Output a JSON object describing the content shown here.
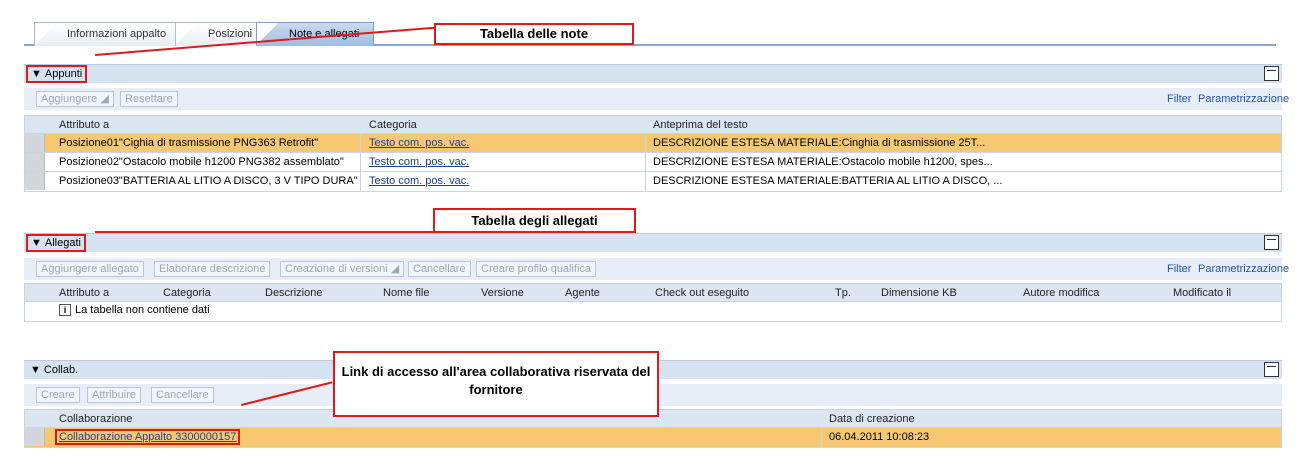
{
  "tabs": [
    "Informazioni appalto",
    "Posizioni",
    "Note e allegati"
  ],
  "callouts": {
    "notes": "Tabella delle note",
    "attachments": "Tabella degli allegati",
    "collab": "Link di accesso all'area collaborativa riservata del fornitore"
  },
  "appunti": {
    "title": "Appunti",
    "buttons": [
      "Aggiungere",
      "Resettare"
    ],
    "filter": "Filter",
    "settings": "Parametrizzazione",
    "columns": [
      "Attributo a",
      "Categoria",
      "Anteprima del testo"
    ],
    "rows": [
      {
        "attr": "Posizione01\"Cighia di trasmissione PNG363 Retrofit\"",
        "cat": "Testo com. pos. vac.",
        "preview": "DESCRIZIONE ESTESA MATERIALE:Cinghia di trasmissione 25T..."
      },
      {
        "attr": "Posizione02\"Ostacolo mobile h1200 PNG382 assemblato\"",
        "cat": "Testo com. pos. vac.",
        "preview": "DESCRIZIONE ESTESA MATERIALE:Ostacolo mobile h1200, spes..."
      },
      {
        "attr": "Posizione03\"BATTERIA AL LITIO A DISCO, 3 V TIPO DURA\"",
        "cat": "Testo com. pos. vac.",
        "preview": "DESCRIZIONE ESTESA MATERIALE:BATTERIA AL LITIO A DISCO, ..."
      }
    ]
  },
  "allegati": {
    "title": "Allegati",
    "buttons": [
      "Aggiungere allegato",
      "Elaborare descrizione",
      "Creazione di versioni",
      "Cancellare",
      "Creare profilo qualifica"
    ],
    "filter": "Filter",
    "settings": "Parametrizzazione",
    "columns": [
      "Attributo a",
      "Categoria",
      "Descrizione",
      "Nome file",
      "Versione",
      "Agente",
      "Check out eseguito",
      "Tp.",
      "Dimensione KB",
      "Autore modifica",
      "Modificato il"
    ],
    "empty": "La tabella non contiene dati"
  },
  "collab": {
    "title": "Collab.",
    "buttons": [
      "Creare",
      "Attribuire",
      "Cancellare"
    ],
    "columns": [
      "Collaborazione",
      "Data di creazione"
    ],
    "row": {
      "name": "Collaborazione Appalto 3300000157",
      "date": "06.04.2011 10:08:23"
    }
  }
}
